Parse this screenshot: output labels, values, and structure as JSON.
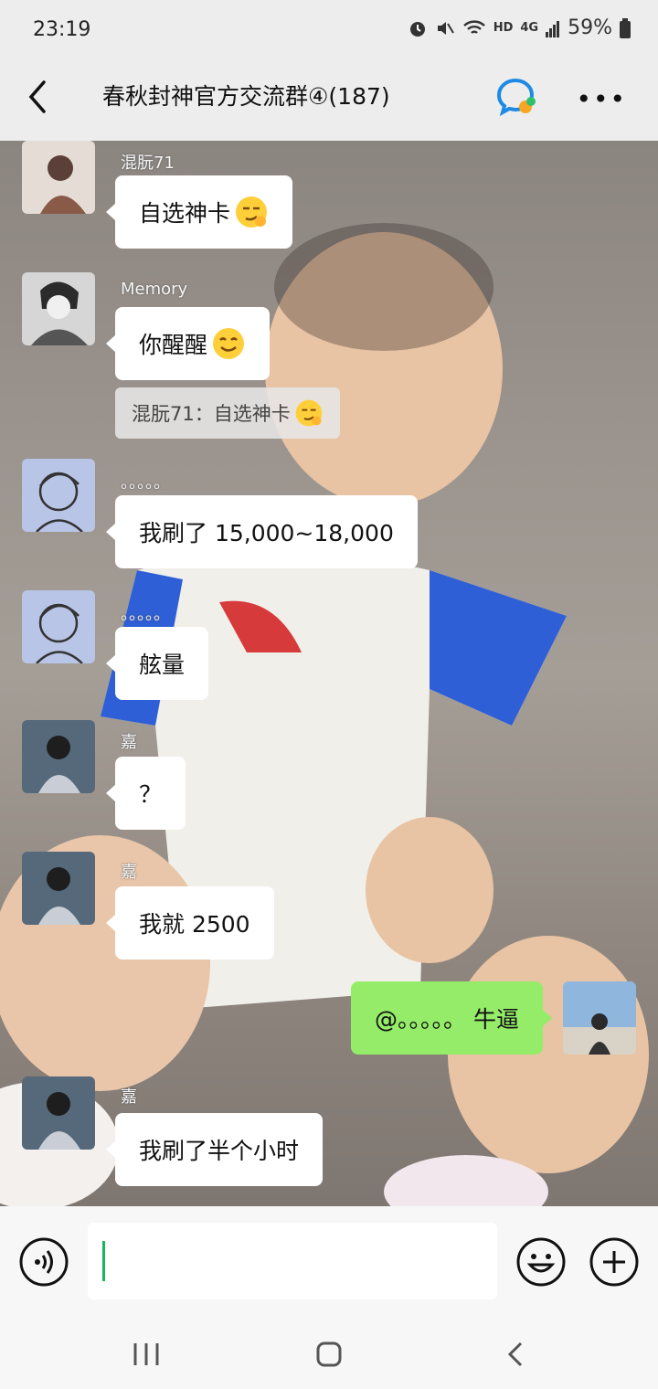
{
  "status_bar": {
    "time": "23:19",
    "network_label": "HD",
    "signal_label": "4G",
    "battery": "59%"
  },
  "header": {
    "title": "春秋封神官方交流群④(187)",
    "back_icon": "chevron-left-icon",
    "group_icon": "group-chat-icon",
    "more_icon": "more-dots-icon"
  },
  "messages": [
    {
      "sender": "混朊71",
      "text": "自选神卡",
      "emoji": "smirk-emoji"
    },
    {
      "sender": "Memory",
      "text": "你醒醒",
      "emoji": "smile-emoji",
      "quote": "混朊71：自选神卡"
    },
    {
      "sender": "。。。。。",
      "text": "我刷了 15,000~18,000"
    },
    {
      "sender": "。。。。。",
      "text": "舷量"
    },
    {
      "sender": "嘉",
      "text": "？"
    },
    {
      "sender": "嘉",
      "text": "我就 2500"
    },
    {
      "sender": "me",
      "text": "@。。。。。 牛逼",
      "outgoing": true
    },
    {
      "sender": "嘉",
      "text": "我刷了半个小时"
    }
  ],
  "input_bar": {
    "voice_icon": "voice-icon",
    "emoji_icon": "emoji-icon",
    "plus_icon": "plus-icon",
    "value": ""
  },
  "nav_bar": {
    "recent_icon": "recent-apps-icon",
    "home_icon": "home-icon",
    "back_icon": "nav-back-icon"
  },
  "colors": {
    "outgoing_bubble": "#95ec69",
    "incoming_bubble": "#ffffff",
    "caret": "#19b45b",
    "group_icon_blue": "#1d8ae5"
  }
}
